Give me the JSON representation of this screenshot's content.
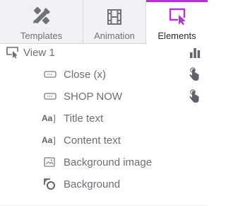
{
  "tabs": [
    {
      "label": "Templates",
      "icon": "templates-icon"
    },
    {
      "label": "Animation",
      "icon": "film-icon"
    },
    {
      "label": "Elements",
      "icon": "cursor-select-icon"
    }
  ],
  "tree": {
    "view": {
      "label": "View 1",
      "icon": "view-icon",
      "action_icon": "bar-chart-icon"
    },
    "items": [
      {
        "label": "Close (x)",
        "icon": "button-icon",
        "action_icon": "tap-hand-icon"
      },
      {
        "label": "SHOP NOW",
        "icon": "button-icon",
        "action_icon": "tap-hand-icon"
      },
      {
        "label": "Title text",
        "icon": "text-icon"
      },
      {
        "label": "Content text",
        "icon": "text-icon"
      },
      {
        "label": "Background image",
        "icon": "image-icon"
      },
      {
        "label": "Background",
        "icon": "background-icon"
      }
    ],
    "text_icon_glyph": "Aa"
  },
  "colors": {
    "accent": "#b733d6",
    "tab_bg": "#f1f1f3",
    "text": "#6b6e73"
  }
}
